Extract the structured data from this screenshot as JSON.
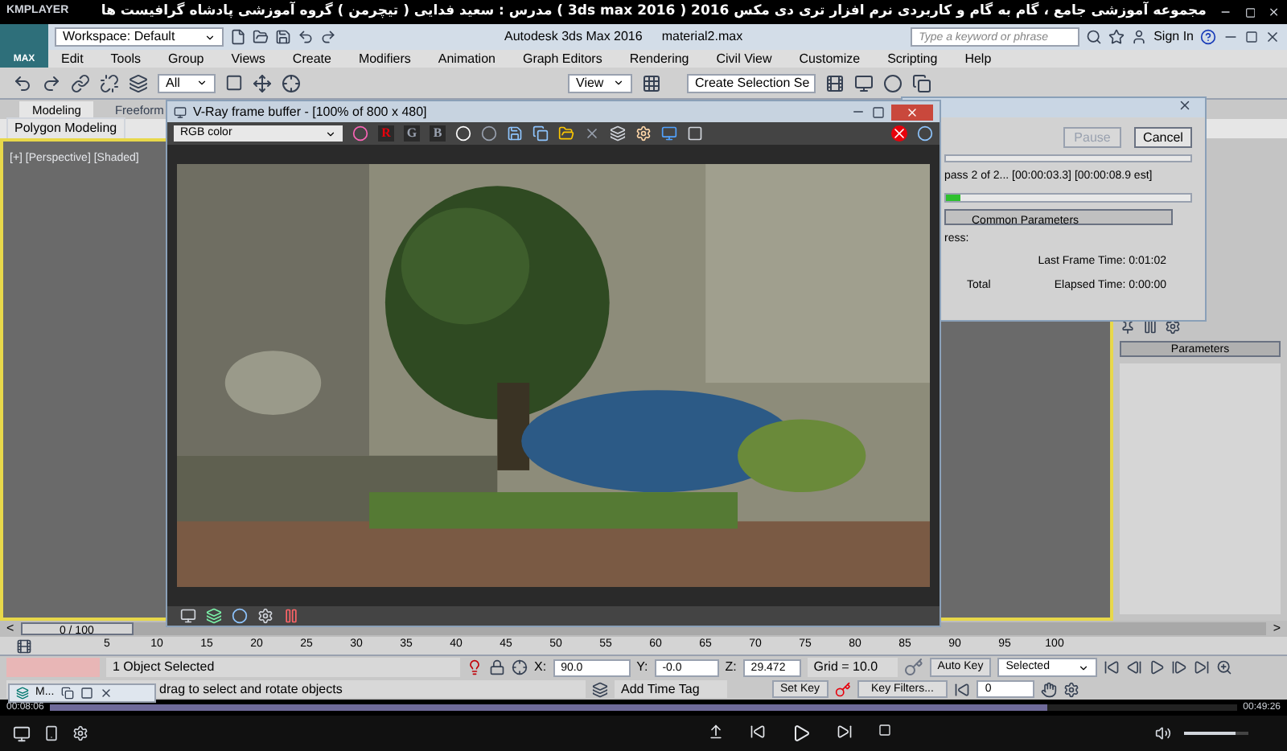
{
  "player": {
    "brand": "KMPLAYER",
    "title": "مجموعه آموزشی جامع ، گام به گام و کاربردی نرم افزار تری دی مکس 2016 ( 3ds max 2016 ) مدرس : سعید فدایی ( تیچرمن ) گروه آموزشی پادشاه گرافیست ها",
    "time_elapsed": "00:08:06",
    "time_total": "00:49:26",
    "seek": {
      "level": 0.84
    },
    "volume": {
      "level": 0.8
    }
  },
  "app": {
    "logo": "MAX",
    "workspace": "Workspace: Default",
    "title": "Autodesk 3ds Max 2016",
    "file": "material2.max",
    "search": {
      "placeholder": "Type a keyword or phrase"
    },
    "sign_in": "Sign In"
  },
  "menu": [
    "Edit",
    "Tools",
    "Group",
    "Views",
    "Create",
    "Modifiers",
    "Animation",
    "Graph Editors",
    "Rendering",
    "Civil View",
    "Customize",
    "Scripting",
    "Help"
  ],
  "toolbar": {
    "selection_filter": "All",
    "reference": "View",
    "named_selection": "Create Selection Se"
  },
  "ribbon": {
    "tabs": [
      {
        "label": "Modeling",
        "selected": true
      },
      {
        "label": "Freeform",
        "selected": false
      }
    ],
    "panel": "Polygon Modeling"
  },
  "viewport": {
    "label": "[+] [Perspective] [Shaded]"
  },
  "vray": {
    "title": "V-Ray frame buffer - [100% of 800 x 480]",
    "channel": "RGB color",
    "channels": [
      {
        "label": "R",
        "on": true
      },
      {
        "label": "G",
        "on": false
      },
      {
        "label": "B",
        "on": false
      }
    ]
  },
  "render_dialog": {
    "pause": {
      "label": "Pause",
      "disabled": true
    },
    "cancel": {
      "label": "Cancel",
      "disabled": false
    },
    "status": "pass 2 of 2... [00:00:03.3] [00:00:08.9 est]",
    "progress": {
      "level": 0.06
    },
    "section": "Common Parameters",
    "progress_label": "ress:",
    "last_frame_time": "Last Frame Time: 0:01:02",
    "total": "Total",
    "elapsed_time": "Elapsed Time: 0:00:00"
  },
  "command_panel": {
    "rollout": "Parameters"
  },
  "time_slider": {
    "label": "0 / 100",
    "level": 0,
    "prev": "<",
    "next": ">"
  },
  "ruler": [
    "5",
    "10",
    "15",
    "20",
    "25",
    "30",
    "35",
    "40",
    "45",
    "50",
    "55",
    "60",
    "65",
    "70",
    "75",
    "80",
    "85",
    "90",
    "95",
    "100"
  ],
  "status": {
    "selection": "1 Object Selected",
    "prompt": "drag to select and rotate objects",
    "x": {
      "label": "X:",
      "value": "90.0"
    },
    "y": {
      "label": "Y:",
      "value": "-0.0"
    },
    "z": {
      "label": "Z:",
      "value": "29.472"
    },
    "grid": "Grid = 10.0",
    "add_time_tag": "Add Time Tag"
  },
  "animation": {
    "auto_key": "Auto Key",
    "set_key": "Set Key",
    "key_mode": "Selected",
    "key_filters": "Key Filters...",
    "frame": "0"
  },
  "taskbar": {
    "label": "M..."
  }
}
